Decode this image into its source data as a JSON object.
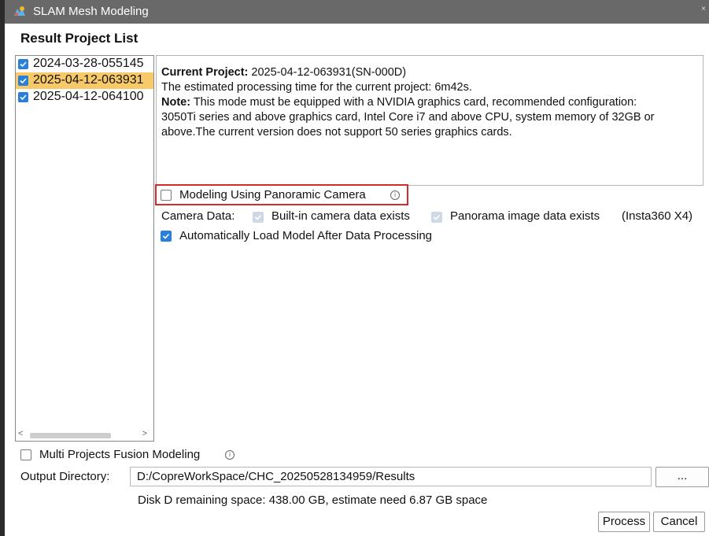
{
  "window": {
    "title": "SLAM Mesh Modeling",
    "close_glyph": "×",
    "app_icon": "slam-app-icon"
  },
  "heading": "Result Project List",
  "projects": [
    {
      "label": "2024-03-28-055145",
      "checked": true,
      "selected": false
    },
    {
      "label": "2025-04-12-063931",
      "checked": true,
      "selected": true
    },
    {
      "label": "2025-04-12-064100",
      "checked": true,
      "selected": false
    }
  ],
  "scroll": {
    "left": "<",
    "right": ">"
  },
  "info": {
    "current_label": "Current Project:",
    "current_value": " 2025-04-12-063931(SN-000D)",
    "estimate": "The estimated processing time for the current project: 6m42s.",
    "note_label": "Note:",
    "note_line1": " This mode must be equipped with a NVIDIA graphics card, recommended configuration:",
    "note_line2": "3050Ti series and above graphics card, Intel Core i7 and above CPU, system memory of 32GB or",
    "note_line3": "above.The current version does not support 50 series graphics cards."
  },
  "options": {
    "panoramic_label": "Modeling Using Panoramic Camera",
    "panoramic_checked": false,
    "camera_data_label": "Camera Data:",
    "builtin_label": "Built-in camera data exists",
    "panorama_label": "Panorama image data exists",
    "device_label": "(Insta360 X4)",
    "auto_load_label": "Automatically Load Model After Data Processing",
    "auto_load_checked": true,
    "fusion_label": "Multi Projects Fusion Modeling",
    "fusion_checked": false
  },
  "info_glyph": "i",
  "output": {
    "label": "Output Directory:",
    "path": "D:/CopreWorkSpace/CHC_20250528134959/Results",
    "browse_label": "...",
    "disk_info": "Disk D remaining space: 438.00 GB, estimate need 6.87 GB space"
  },
  "buttons": {
    "process": "Process",
    "cancel": "Cancel"
  },
  "colors": {
    "accent": "#2a7fd8",
    "selection": "#f7c969",
    "highlight_border": "#d42a2a",
    "titlebar": "#696969"
  }
}
